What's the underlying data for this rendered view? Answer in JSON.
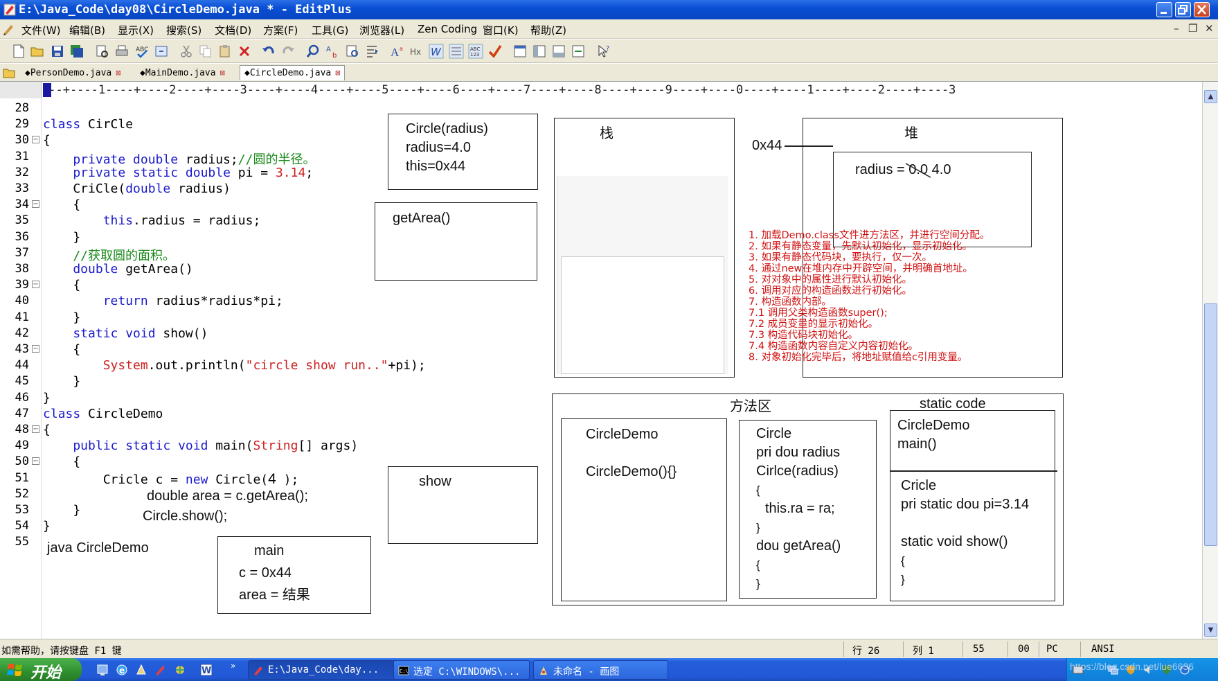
{
  "window": {
    "title": "E:\\Java_Code\\day08\\CircleDemo.java * - EditPlus"
  },
  "menu": [
    "文件(W)",
    "编辑(B)",
    "显示(X)",
    "搜索(S)",
    "文档(D)",
    "方案(F)",
    "工具(G)",
    "浏览器(L)",
    "Zen Coding",
    "窗口(K)",
    "帮助(Z)"
  ],
  "tabs": [
    "PersonDemo.java",
    "MainDemo.java",
    "CircleDemo.java"
  ],
  "ruler": "---+----1----+----2----+----3----+----4----+----5----+----6----+----7----+----8----+----9----+----0----+----1----+----2----+----3",
  "line_numbers": [
    "28",
    "29",
    "30",
    "31",
    "32",
    "33",
    "34",
    "35",
    "36",
    "37",
    "38",
    "39",
    "40",
    "41",
    "42",
    "43",
    "44",
    "45",
    "46",
    "47",
    "48",
    "49",
    "50",
    "51",
    "52",
    "53",
    "54",
    "55"
  ],
  "code": {
    "l29": [
      "class",
      " CirCle"
    ],
    "l30": "{",
    "l31": [
      "    private double",
      " radius;",
      "//圆的半径。"
    ],
    "l32": [
      "    private static double",
      " pi = ",
      "3.14",
      ";"
    ],
    "l33": [
      "    CriCle(",
      "double",
      " radius)"
    ],
    "l34": "    {",
    "l35": [
      "        this",
      ".radius = radius;"
    ],
    "l36": "    }",
    "l37": "    //获取圆的面积。",
    "l38": [
      "    double",
      " getArea()"
    ],
    "l39": "    {",
    "l40": [
      "        return",
      " radius*radius*pi;"
    ],
    "l41": "    }",
    "l42": [
      "    static void",
      " show()"
    ],
    "l43": "    {",
    "l44": [
      "        System",
      ".out.println(",
      "\"circle show run..\"",
      "+pi);"
    ],
    "l45": "    }",
    "l46": "}",
    "l47": [
      "class",
      " CircleDemo"
    ],
    "l48": "{",
    "l49": [
      "    public static void",
      " main(",
      "String",
      "[] args)"
    ],
    "l50": "    {",
    "l51": [
      "        Cricle c = ",
      "new",
      " Circle(",
      "4",
      " );"
    ],
    "l53": "    }",
    "l54": "}"
  },
  "handwritten": {
    "area_line": "double area =    c.getArea();",
    "show_line": "Circle.show();",
    "java_cmd": "java CircleDemo"
  },
  "boxes": {
    "circle_frame": [
      "Circle(radius)",
      "radius=4.0",
      "this=0x44"
    ],
    "getarea_frame": "getArea()",
    "show_frame": "show",
    "main_frame": {
      "title": "main",
      "c": "c = 0x44",
      "area": "area = 结果"
    },
    "stack": {
      "title": "栈"
    },
    "heap": {
      "title": "堆",
      "addr": "0x44",
      "radius_label": "radius = ",
      "radius_old": "0.0",
      "radius_new": "4.0"
    },
    "method_area": {
      "title": "方法区"
    },
    "circledemo_class": [
      "CircleDemo",
      "CircleDemo(){}"
    ],
    "circle_class": [
      "Circle",
      "pri dou radius",
      "Cirlce(radius)",
      "{",
      "this.ra = ra;",
      "}",
      "dou getArea()",
      "{",
      "}"
    ],
    "static_code": {
      "title": "static code",
      "top": [
        "CircleDemo",
        "main()"
      ],
      "bottom": [
        "Cricle",
        "pri static dou pi=3.14",
        "static void show()",
        "{",
        "}"
      ]
    }
  },
  "notes": [
    "1. 加载Demo.class文件进方法区，并进行空间分配。",
    "2. 如果有静态变量，先默认初始化，显示初始化。",
    "3. 如果有静态代码块，要执行，仅一次。",
    "4. 通过new在堆内存中开辟空间，并明确首地址。",
    "5. 对对象中的属性进行默认初始化。",
    "6. 调用对应的构造函数进行初始化。",
    "7. 构造函数内部。",
    "7.1 调用父类构造函数super();",
    "7.2 成员变量的显示初始化。",
    "7.3 构造代码块初始化。",
    "7.4 构造函数内容自定义内容初始化。",
    "8. 对象初始化完毕后，将地址赋值给c引用变量。"
  ],
  "status": {
    "help": "如需帮助，请按键盘 F1 键",
    "row": "行 26",
    "col": "列 1",
    "v55": "55",
    "v00": "00",
    "pc": "PC",
    "enc": "ANSI"
  },
  "taskbar": {
    "start": "开始",
    "items": [
      "E:\\Java_Code\\day...",
      "选定 C:\\WINDOWS\\...",
      "未命名 - 画图"
    ],
    "watermark": "https://blog.csdn.net/lue6636"
  },
  "colors": {
    "keyword": "#1a1acc",
    "string": "#cc2020",
    "comment": "#1a8a1a",
    "note": "#d01010"
  }
}
